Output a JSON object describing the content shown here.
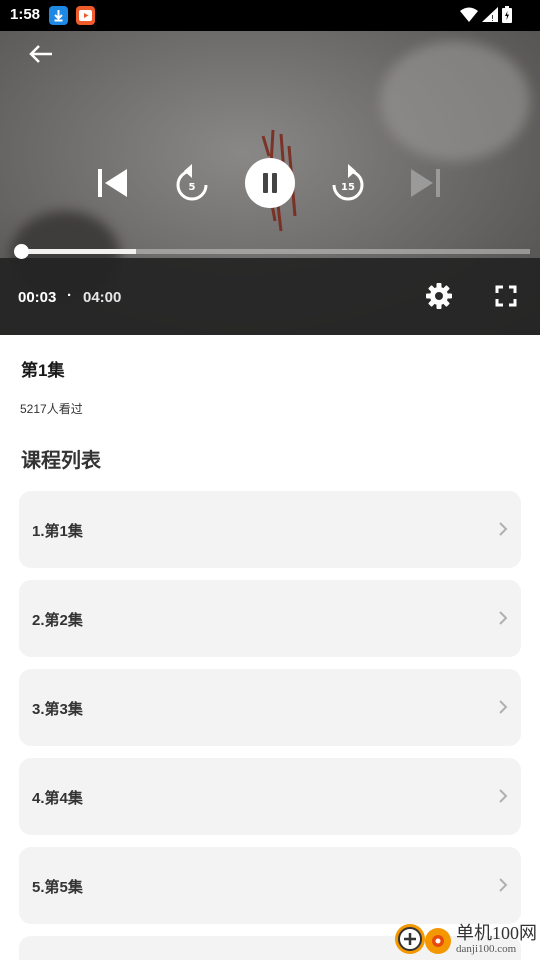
{
  "status_bar": {
    "time": "1:58",
    "download_icon_color": "#1e88e5",
    "app_icon_color": "#e64a19"
  },
  "player": {
    "current_time": "00:03",
    "separator": "·",
    "total_time": "04:00",
    "progress_fraction": 0.0125,
    "buffered_fraction": 0.234,
    "rewind_seconds": "5",
    "forward_seconds": "15"
  },
  "episode": {
    "title": "第1集",
    "views": "5217人看过"
  },
  "course_list": {
    "title": "课程列表",
    "items": [
      {
        "label": "1.第1集"
      },
      {
        "label": "2.第2集"
      },
      {
        "label": "3.第3集"
      },
      {
        "label": "4.第4集"
      },
      {
        "label": "5.第5集"
      }
    ]
  },
  "watermark": {
    "line1": "单机100网",
    "line2": "danji100.com"
  }
}
